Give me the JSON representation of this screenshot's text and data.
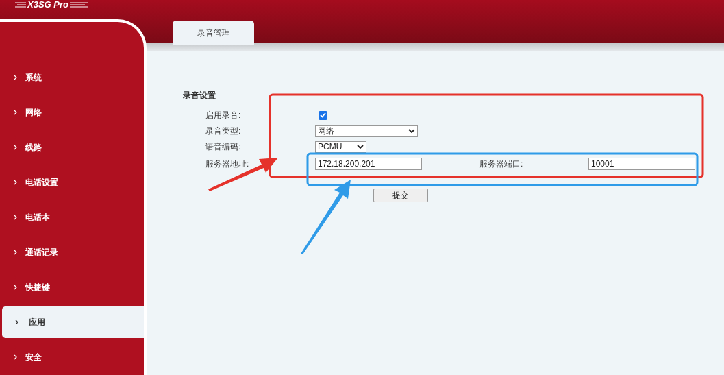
{
  "logo": {
    "text": "X3SG Pro"
  },
  "sidebar": {
    "items": [
      {
        "label": "系统",
        "selected": false
      },
      {
        "label": "网络",
        "selected": false
      },
      {
        "label": "线路",
        "selected": false
      },
      {
        "label": "电话设置",
        "selected": false
      },
      {
        "label": "电话本",
        "selected": false
      },
      {
        "label": "通话记录",
        "selected": false
      },
      {
        "label": "快捷键",
        "selected": false
      },
      {
        "label": "应用",
        "selected": true
      },
      {
        "label": "安全",
        "selected": false
      }
    ]
  },
  "tabs": [
    {
      "label": "录音管理",
      "selected": true
    }
  ],
  "section": {
    "title": "录音设置"
  },
  "form": {
    "enable_recording": {
      "label": "启用录音:",
      "checked": true
    },
    "recording_type": {
      "label": "录音类型:",
      "value": "网络"
    },
    "codec": {
      "label": "语音编码:",
      "value": "PCMU"
    },
    "server_address": {
      "label": "服务器地址:",
      "value": "172.18.200.201"
    },
    "server_port": {
      "label": "服务器端口:",
      "value": "10001"
    },
    "submit": "提交"
  }
}
